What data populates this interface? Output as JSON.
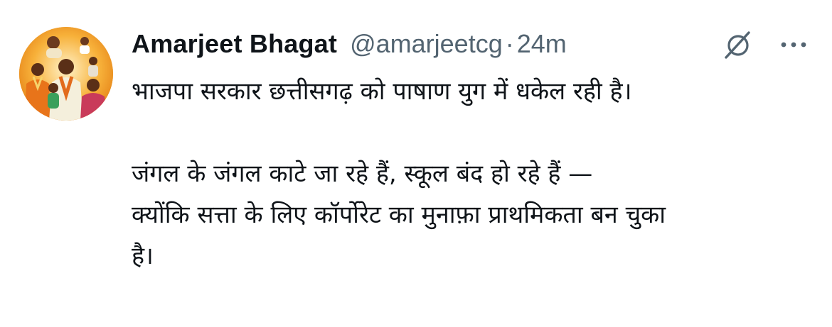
{
  "tweet": {
    "author": {
      "display_name": "Amarjeet Bhagat",
      "handle": "@amarjeetcg",
      "separator": "·",
      "time": "24m"
    },
    "icons": {
      "grok": "grok-icon",
      "more": "more-options-icon",
      "avatar": "profile-avatar"
    },
    "text": {
      "line1": "भाजपा सरकार छत्तीसगढ़ को पाषाण युग में धकेल रही है।",
      "line2": "जंगल के जंगल काटे जा रहे हैं, स्कूल बंद हो रहे हैं —",
      "line3": "क्योंकि सत्ता के लिए कॉर्पोरेट का मुनाफ़ा प्राथमिकता बन चुका",
      "line4": "है।"
    },
    "colors": {
      "primary_text": "#0f1419",
      "secondary_text": "#536471",
      "avatar_ring": "#f6a623"
    }
  }
}
